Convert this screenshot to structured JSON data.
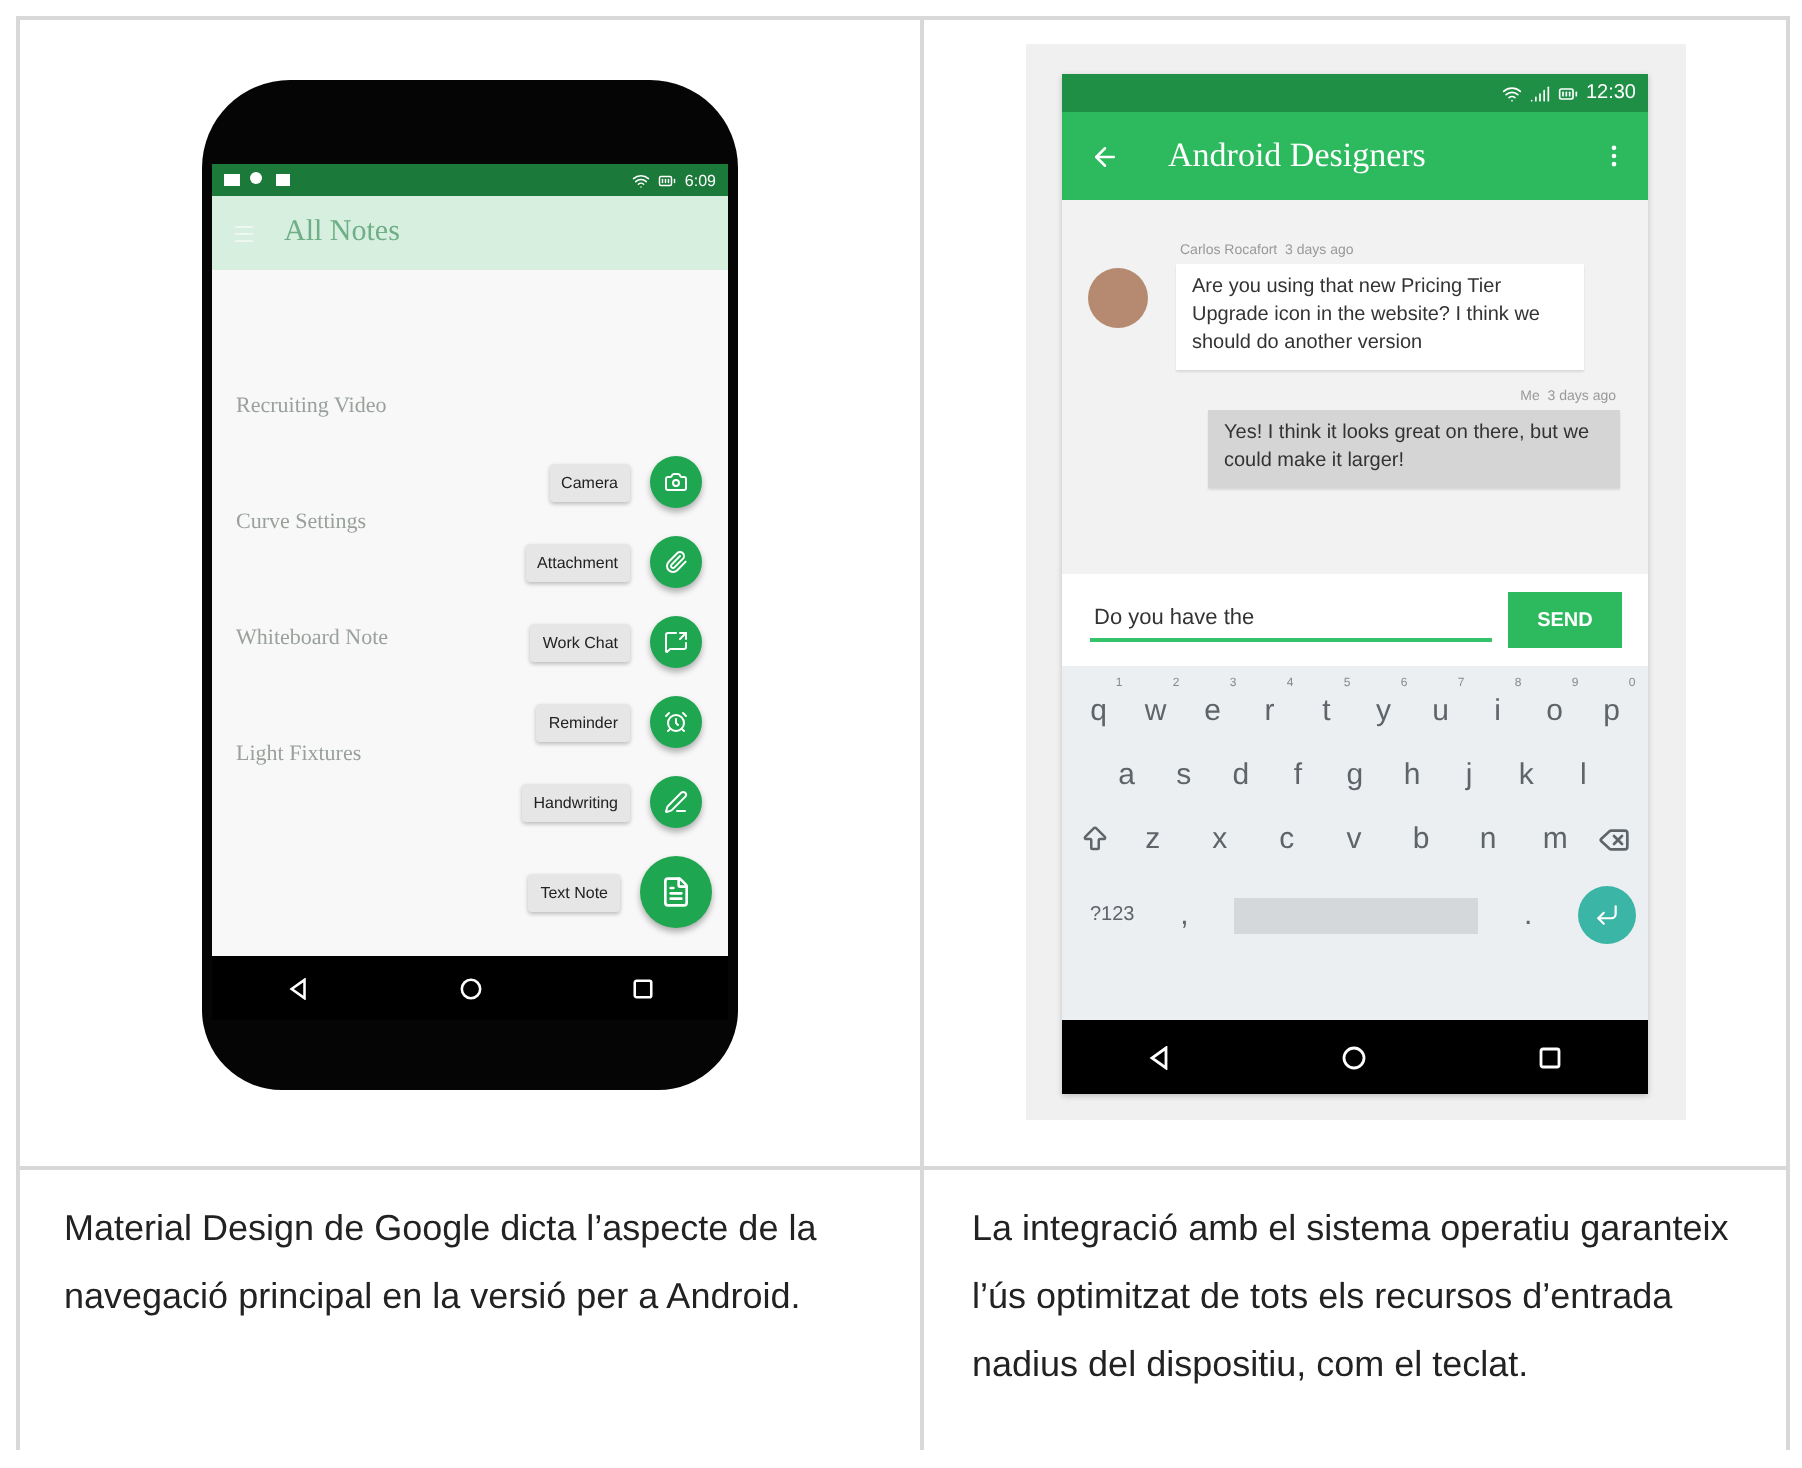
{
  "left_screenshot": {
    "status_time": "6:09",
    "app_title": "All Notes",
    "notes": [
      "Recruiting Video",
      "Curve Settings",
      "Whiteboard Note",
      "Light Fixtures"
    ],
    "actions": [
      {
        "label": "Camera",
        "primary": false
      },
      {
        "label": "Attachment",
        "primary": false
      },
      {
        "label": "Work Chat",
        "primary": false
      },
      {
        "label": "Reminder",
        "primary": false
      },
      {
        "label": "Handwriting",
        "primary": false
      },
      {
        "label": "Text Note",
        "primary": true
      }
    ]
  },
  "right_screenshot": {
    "status_time": "12:30",
    "title": "Android Designers",
    "messages": [
      {
        "kind": "incoming",
        "sender": "Carlos Rocafort",
        "time": "3 days ago",
        "text": "Are you using that new Pricing Tier Upgrade icon in the website? I think we should do another version"
      },
      {
        "kind": "outgoing",
        "sender": "Me",
        "time": "3 days ago",
        "text": "Yes! I think it looks great on there, but we could make it larger!"
      }
    ],
    "input_value": "Do you have the",
    "send_label": "SEND",
    "keyboard": {
      "top_row": [
        {
          "key": "q",
          "hint": "1"
        },
        {
          "key": "w",
          "hint": "2"
        },
        {
          "key": "e",
          "hint": "3"
        },
        {
          "key": "r",
          "hint": "4"
        },
        {
          "key": "t",
          "hint": "5"
        },
        {
          "key": "y",
          "hint": "6"
        },
        {
          "key": "u",
          "hint": "7"
        },
        {
          "key": "i",
          "hint": "8"
        },
        {
          "key": "o",
          "hint": "9"
        },
        {
          "key": "p",
          "hint": "0"
        }
      ],
      "middle_row": [
        "a",
        "s",
        "d",
        "f",
        "g",
        "h",
        "j",
        "k",
        "l"
      ],
      "bottom_row": [
        "z",
        "x",
        "c",
        "v",
        "b",
        "n",
        "m"
      ],
      "symbols_key": "?123",
      "comma_key": ",",
      "period_key": "."
    }
  },
  "captions": [
    "Material Design de Google dicta l’aspecte de la navegació principal en la versió per a Android.",
    "La integració amb el sistema operatiu garanteix l’ús optimitzat de tots els recursos d’entrada nadius del dispositiu, com el teclat."
  ]
}
